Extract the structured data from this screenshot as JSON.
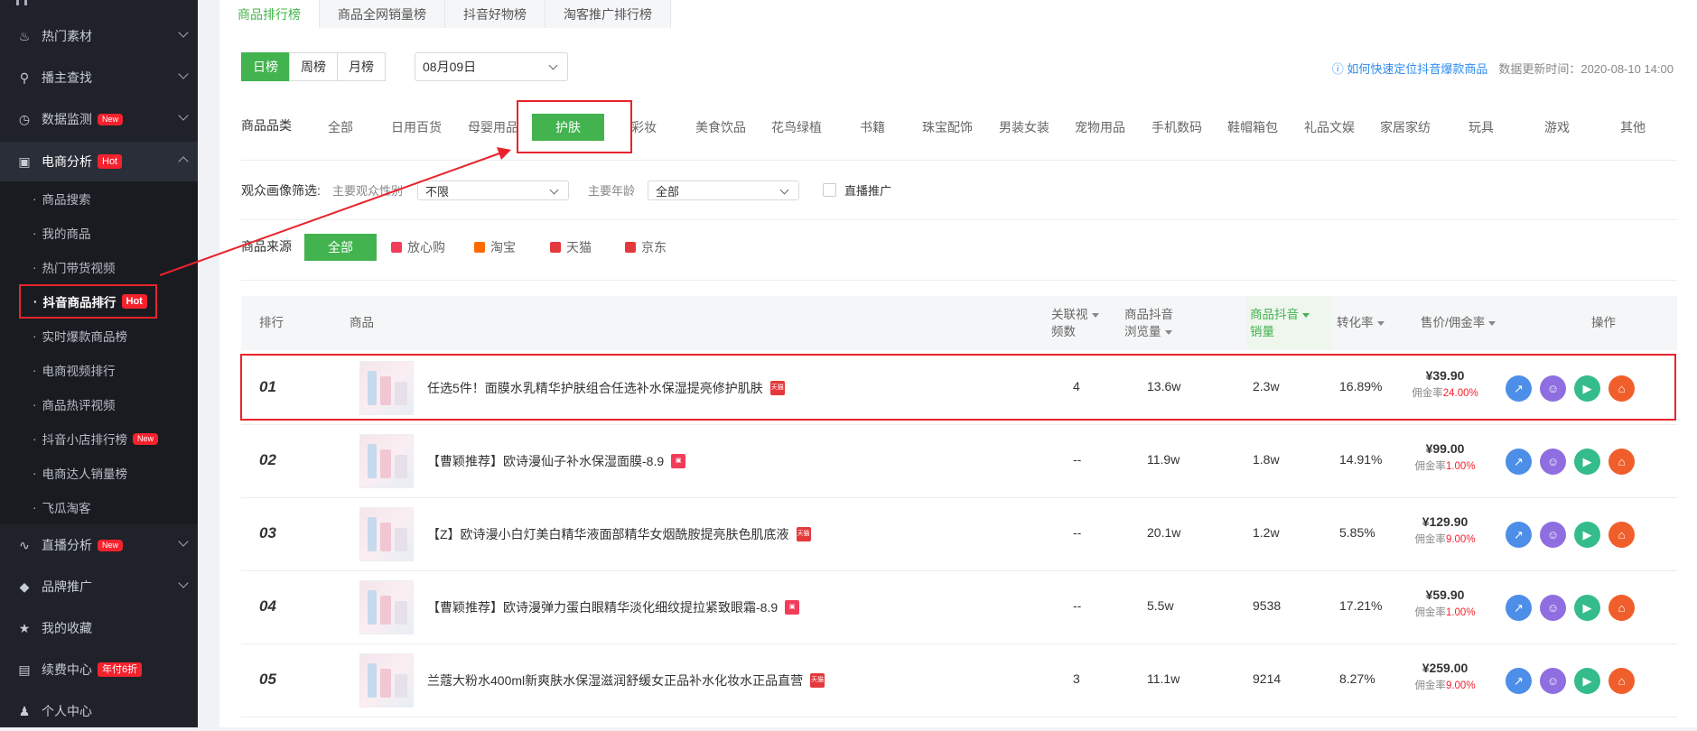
{
  "sidebar": {
    "items": [
      {
        "label": "热门素材",
        "icon": "fire-icon"
      },
      {
        "label": "播主查找",
        "icon": "search-icon"
      },
      {
        "label": "数据监测",
        "icon": "monitor-icon",
        "badge": "New"
      },
      {
        "label": "电商分析",
        "icon": "bag-icon",
        "badge": "Hot"
      },
      {
        "label": "直播分析",
        "icon": "chart-icon",
        "badge": "New"
      },
      {
        "label": "品牌推广",
        "icon": "diamond-icon"
      },
      {
        "label": "我的收藏",
        "icon": "star-icon"
      },
      {
        "label": "续费中心",
        "icon": "card-icon",
        "badge": "年付6折"
      },
      {
        "label": "个人中心",
        "icon": "user-icon"
      }
    ],
    "sub_items": [
      {
        "label": "商品搜索"
      },
      {
        "label": "我的商品"
      },
      {
        "label": "热门带货视频"
      },
      {
        "label": "抖音商品排行",
        "badge": "Hot"
      },
      {
        "label": "实时爆款商品榜"
      },
      {
        "label": "电商视频排行"
      },
      {
        "label": "商品热评视频"
      },
      {
        "label": "抖音小店排行榜",
        "badge": "New"
      },
      {
        "label": "电商达人销量榜"
      },
      {
        "label": "飞瓜淘客"
      }
    ]
  },
  "tabs": [
    "商品排行榜",
    "商品全网销量榜",
    "抖音好物榜",
    "淘客推广排行榜"
  ],
  "period": {
    "options": [
      "日榜",
      "周榜",
      "月榜"
    ],
    "date": "08月09日"
  },
  "help": {
    "link": "如何快速定位抖音爆款商品",
    "update": "数据更新时间：2020-08-10 14:00"
  },
  "category": {
    "label": "商品品类",
    "items": [
      "全部",
      "日用百货",
      "母婴用品",
      "护肤",
      "彩妆",
      "美食饮品",
      "花鸟绿植",
      "书籍",
      "珠宝配饰",
      "男装女装",
      "宠物用品",
      "手机数码",
      "鞋帽箱包",
      "礼品文娱",
      "家居家纺",
      "玩具",
      "游戏",
      "其他"
    ]
  },
  "audience": {
    "label": "观众画像筛选:",
    "gender_label": "主要观众性别",
    "gender_value": "不限",
    "age_label": "主要年龄",
    "age_value": "全部",
    "live_label": "直播推广"
  },
  "source": {
    "label": "商品来源",
    "items": [
      {
        "label": "全部"
      },
      {
        "label": "放心购",
        "color": "#f23d5a"
      },
      {
        "label": "淘宝",
        "color": "#ff6a00"
      },
      {
        "label": "天猫",
        "color": "#e4393c"
      },
      {
        "label": "京东",
        "color": "#e4393c"
      }
    ]
  },
  "table": {
    "headers": {
      "rank": "排行",
      "product": "商品",
      "videos_1": "关联视",
      "videos_2": "频数",
      "views_1": "商品抖音",
      "views_2": "浏览量",
      "sales_1": "商品抖音",
      "sales_2": "销量",
      "conv": "转化率",
      "price": "售价/佣金率",
      "ops": "操作"
    },
    "rows": [
      {
        "rank": "01",
        "name": "任选5件！面膜水乳精华护肤组合任选补水保湿提亮修护肌肤",
        "shop": "天猫",
        "videos": "4",
        "views": "13.6w",
        "sales": "2.3w",
        "conv": "16.89%",
        "price": "¥39.90",
        "comm_label": "佣金率",
        "comm": "24.00%"
      },
      {
        "rank": "02",
        "name": "【曹颖推荐】欧诗漫仙子补水保湿面膜-8.9",
        "shop": "放心购",
        "videos": "--",
        "views": "11.9w",
        "sales": "1.8w",
        "conv": "14.91%",
        "price": "¥99.00",
        "comm_label": "佣金率",
        "comm": "1.00%"
      },
      {
        "rank": "03",
        "name": "【Z】欧诗漫小白灯美白精华液面部精华女烟酰胺提亮肤色肌底液",
        "shop": "天猫",
        "videos": "--",
        "views": "20.1w",
        "sales": "1.2w",
        "conv": "5.85%",
        "price": "¥129.90",
        "comm_label": "佣金率",
        "comm": "9.00%"
      },
      {
        "rank": "04",
        "name": "【曹颖推荐】欧诗漫弹力蛋白眼精华淡化细纹提拉紧致眼霜-8.9",
        "shop": "放心购",
        "videos": "--",
        "views": "5.5w",
        "sales": "9538",
        "conv": "17.21%",
        "price": "¥59.90",
        "comm_label": "佣金率",
        "comm": "1.00%"
      },
      {
        "rank": "05",
        "name": "兰蔻大粉水400ml新爽肤水保湿滋润舒缓女正品补水化妆水正品直营",
        "shop": "天猫",
        "videos": "3",
        "views": "11.1w",
        "sales": "9214",
        "conv": "8.27%",
        "price": "¥259.00",
        "comm_label": "佣金率",
        "comm": "9.00%"
      }
    ]
  },
  "colors": {
    "accent": "#43b34f",
    "highlight": "#e8232c",
    "sidebar_bg": "#1f2229"
  }
}
